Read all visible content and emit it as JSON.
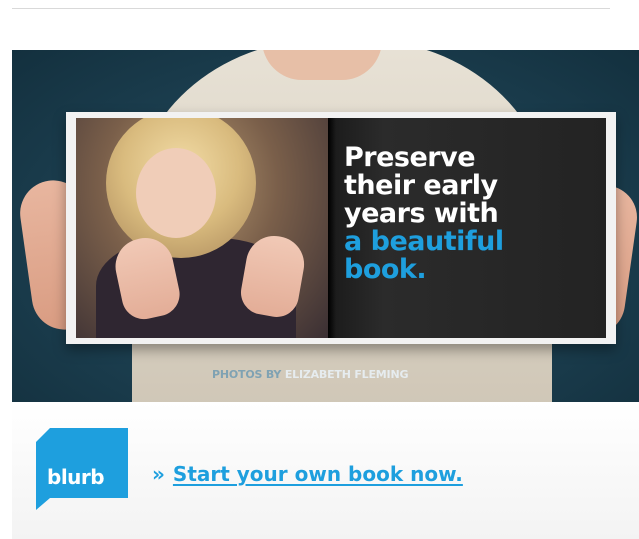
{
  "headline": {
    "line1": "Preserve",
    "line2": "their early",
    "line3": "years with",
    "line4": "a beautiful",
    "line5": "book."
  },
  "credit": {
    "prefix": "PHOTOS BY",
    "name": "ELIZABETH FLEMING"
  },
  "logo": {
    "text": "blurb"
  },
  "cta": {
    "arrow": "»",
    "label": "Start your own book now."
  },
  "colors": {
    "accent": "#1e9fde",
    "background_teal": "#1c3f50",
    "page_dark": "#232323"
  },
  "icons": {
    "logo_shape": "blurb-logo-icon"
  }
}
